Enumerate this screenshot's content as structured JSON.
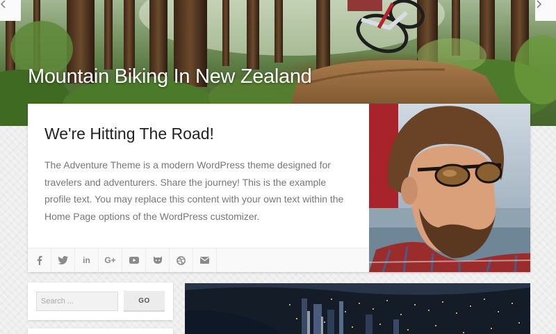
{
  "hero": {
    "title": "Mountain Biking In New Zealand",
    "prev_icon": "chevron-left-icon",
    "next_icon": "chevron-right-icon"
  },
  "profile": {
    "heading": "We're Hitting The Road!",
    "body": "The Adventure Theme is a modern WordPress theme designed for travelers and adventurers. Share the journey! This is the example profile text. You may replace this content with your own text within the Home Page options of the WordPress customizer.",
    "social": [
      {
        "name": "facebook",
        "glyph": "f"
      },
      {
        "name": "twitter",
        "glyph": "t"
      },
      {
        "name": "linkedin",
        "glyph": "in"
      },
      {
        "name": "google-plus",
        "glyph": "G+"
      },
      {
        "name": "youtube",
        "glyph": "▶"
      },
      {
        "name": "github",
        "glyph": "gh"
      },
      {
        "name": "dribbble",
        "glyph": "◎"
      },
      {
        "name": "email",
        "glyph": "✉"
      }
    ]
  },
  "search": {
    "placeholder": "Search ...",
    "button_label": "GO"
  },
  "colors": {
    "card_bg": "#ffffff",
    "page_bg": "#eeeeee",
    "heading": "#222222",
    "body_text": "#777777",
    "icon": "#8a8a8a"
  }
}
